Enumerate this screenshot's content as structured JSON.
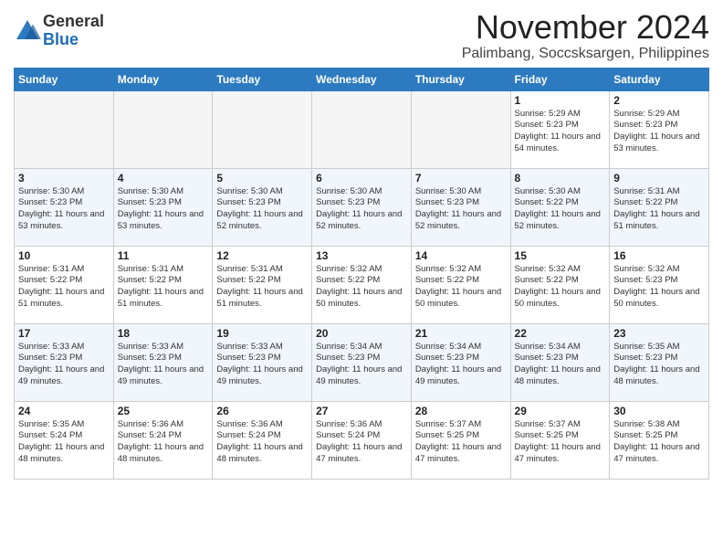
{
  "header": {
    "logo_line1": "General",
    "logo_line2": "Blue",
    "month": "November 2024",
    "location": "Palimbang, Soccsksargen, Philippines"
  },
  "weekdays": [
    "Sunday",
    "Monday",
    "Tuesday",
    "Wednesday",
    "Thursday",
    "Friday",
    "Saturday"
  ],
  "weeks": [
    [
      {
        "day": "",
        "detail": ""
      },
      {
        "day": "",
        "detail": ""
      },
      {
        "day": "",
        "detail": ""
      },
      {
        "day": "",
        "detail": ""
      },
      {
        "day": "",
        "detail": ""
      },
      {
        "day": "1",
        "detail": "Sunrise: 5:29 AM\nSunset: 5:23 PM\nDaylight: 11 hours and 54 minutes."
      },
      {
        "day": "2",
        "detail": "Sunrise: 5:29 AM\nSunset: 5:23 PM\nDaylight: 11 hours and 53 minutes."
      }
    ],
    [
      {
        "day": "3",
        "detail": "Sunrise: 5:30 AM\nSunset: 5:23 PM\nDaylight: 11 hours and 53 minutes."
      },
      {
        "day": "4",
        "detail": "Sunrise: 5:30 AM\nSunset: 5:23 PM\nDaylight: 11 hours and 53 minutes."
      },
      {
        "day": "5",
        "detail": "Sunrise: 5:30 AM\nSunset: 5:23 PM\nDaylight: 11 hours and 52 minutes."
      },
      {
        "day": "6",
        "detail": "Sunrise: 5:30 AM\nSunset: 5:23 PM\nDaylight: 11 hours and 52 minutes."
      },
      {
        "day": "7",
        "detail": "Sunrise: 5:30 AM\nSunset: 5:23 PM\nDaylight: 11 hours and 52 minutes."
      },
      {
        "day": "8",
        "detail": "Sunrise: 5:30 AM\nSunset: 5:22 PM\nDaylight: 11 hours and 52 minutes."
      },
      {
        "day": "9",
        "detail": "Sunrise: 5:31 AM\nSunset: 5:22 PM\nDaylight: 11 hours and 51 minutes."
      }
    ],
    [
      {
        "day": "10",
        "detail": "Sunrise: 5:31 AM\nSunset: 5:22 PM\nDaylight: 11 hours and 51 minutes."
      },
      {
        "day": "11",
        "detail": "Sunrise: 5:31 AM\nSunset: 5:22 PM\nDaylight: 11 hours and 51 minutes."
      },
      {
        "day": "12",
        "detail": "Sunrise: 5:31 AM\nSunset: 5:22 PM\nDaylight: 11 hours and 51 minutes."
      },
      {
        "day": "13",
        "detail": "Sunrise: 5:32 AM\nSunset: 5:22 PM\nDaylight: 11 hours and 50 minutes."
      },
      {
        "day": "14",
        "detail": "Sunrise: 5:32 AM\nSunset: 5:22 PM\nDaylight: 11 hours and 50 minutes."
      },
      {
        "day": "15",
        "detail": "Sunrise: 5:32 AM\nSunset: 5:22 PM\nDaylight: 11 hours and 50 minutes."
      },
      {
        "day": "16",
        "detail": "Sunrise: 5:32 AM\nSunset: 5:23 PM\nDaylight: 11 hours and 50 minutes."
      }
    ],
    [
      {
        "day": "17",
        "detail": "Sunrise: 5:33 AM\nSunset: 5:23 PM\nDaylight: 11 hours and 49 minutes."
      },
      {
        "day": "18",
        "detail": "Sunrise: 5:33 AM\nSunset: 5:23 PM\nDaylight: 11 hours and 49 minutes."
      },
      {
        "day": "19",
        "detail": "Sunrise: 5:33 AM\nSunset: 5:23 PM\nDaylight: 11 hours and 49 minutes."
      },
      {
        "day": "20",
        "detail": "Sunrise: 5:34 AM\nSunset: 5:23 PM\nDaylight: 11 hours and 49 minutes."
      },
      {
        "day": "21",
        "detail": "Sunrise: 5:34 AM\nSunset: 5:23 PM\nDaylight: 11 hours and 49 minutes."
      },
      {
        "day": "22",
        "detail": "Sunrise: 5:34 AM\nSunset: 5:23 PM\nDaylight: 11 hours and 48 minutes."
      },
      {
        "day": "23",
        "detail": "Sunrise: 5:35 AM\nSunset: 5:23 PM\nDaylight: 11 hours and 48 minutes."
      }
    ],
    [
      {
        "day": "24",
        "detail": "Sunrise: 5:35 AM\nSunset: 5:24 PM\nDaylight: 11 hours and 48 minutes."
      },
      {
        "day": "25",
        "detail": "Sunrise: 5:36 AM\nSunset: 5:24 PM\nDaylight: 11 hours and 48 minutes."
      },
      {
        "day": "26",
        "detail": "Sunrise: 5:36 AM\nSunset: 5:24 PM\nDaylight: 11 hours and 48 minutes."
      },
      {
        "day": "27",
        "detail": "Sunrise: 5:36 AM\nSunset: 5:24 PM\nDaylight: 11 hours and 47 minutes."
      },
      {
        "day": "28",
        "detail": "Sunrise: 5:37 AM\nSunset: 5:25 PM\nDaylight: 11 hours and 47 minutes."
      },
      {
        "day": "29",
        "detail": "Sunrise: 5:37 AM\nSunset: 5:25 PM\nDaylight: 11 hours and 47 minutes."
      },
      {
        "day": "30",
        "detail": "Sunrise: 5:38 AM\nSunset: 5:25 PM\nDaylight: 11 hours and 47 minutes."
      }
    ]
  ]
}
